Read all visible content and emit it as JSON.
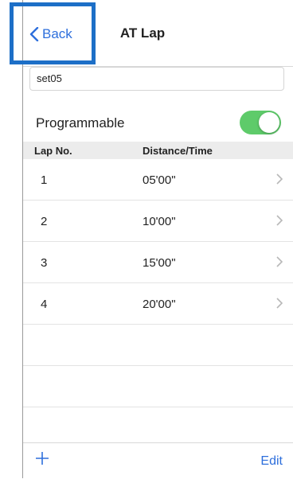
{
  "nav": {
    "back_label": "Back",
    "title": "AT Lap"
  },
  "name_field": {
    "value": "set05"
  },
  "programmable": {
    "label": "Programmable",
    "on": true,
    "color": "#5ecb6a"
  },
  "table": {
    "headers": [
      "Lap No.",
      "Distance/Time"
    ],
    "rows": [
      {
        "lap": "1",
        "value": "05'00\""
      },
      {
        "lap": "2",
        "value": "10'00\""
      },
      {
        "lap": "3",
        "value": "15'00\""
      },
      {
        "lap": "4",
        "value": "20'00\""
      }
    ]
  },
  "toolbar": {
    "add_icon": "plus-icon",
    "edit_label": "Edit"
  },
  "colors": {
    "accent": "#2e6fdc",
    "highlight_box": "#1d6fc7"
  }
}
